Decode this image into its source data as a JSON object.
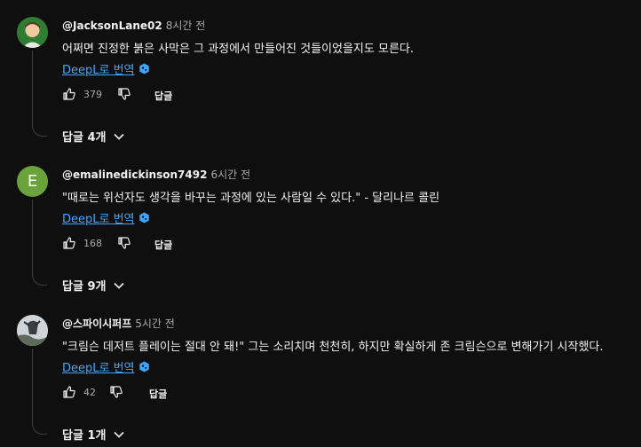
{
  "comments": [
    {
      "author": "@JacksonLane02",
      "time": "8시간 전",
      "text": "어쩌면 진정한 붉은 사막은 그 과정에서 만들어진 것들이었을지도 모른다.",
      "translate_label": "DeepL로 번역",
      "likes": "379",
      "reply_label": "답글",
      "replies_label": "답글 4개",
      "avatar_color": "#2e7d32"
    },
    {
      "author": "@emalinedickinson7492",
      "time": "6시간 전",
      "text": "\"때로는 위선자도 생각을 바꾸는 과정에 있는 사람일 수 있다.\" - 달리나르 콜린",
      "translate_label": "DeepL로 번역",
      "likes": "168",
      "reply_label": "답글",
      "replies_label": "답글 9개",
      "avatar_letter": "E",
      "avatar_color": "#6aa339"
    },
    {
      "author": "@스파이시퍼프",
      "time": "5시간 전",
      "text": "\"크림슨 데저트 플레이는 절대 안 돼!\" 그는 소리치며 천천히, 하지만 확실하게 존 크림슨으로 변해가기 시작했다.",
      "translate_label": "DeepL로 번역",
      "likes": "42",
      "reply_label": "답글",
      "replies_label": "답글 1개",
      "avatar_color": "#9aa0a6"
    }
  ],
  "colors": {
    "background": "#0f0f0f",
    "link": "#3ea6ff",
    "muted": "#aaaaaa"
  }
}
